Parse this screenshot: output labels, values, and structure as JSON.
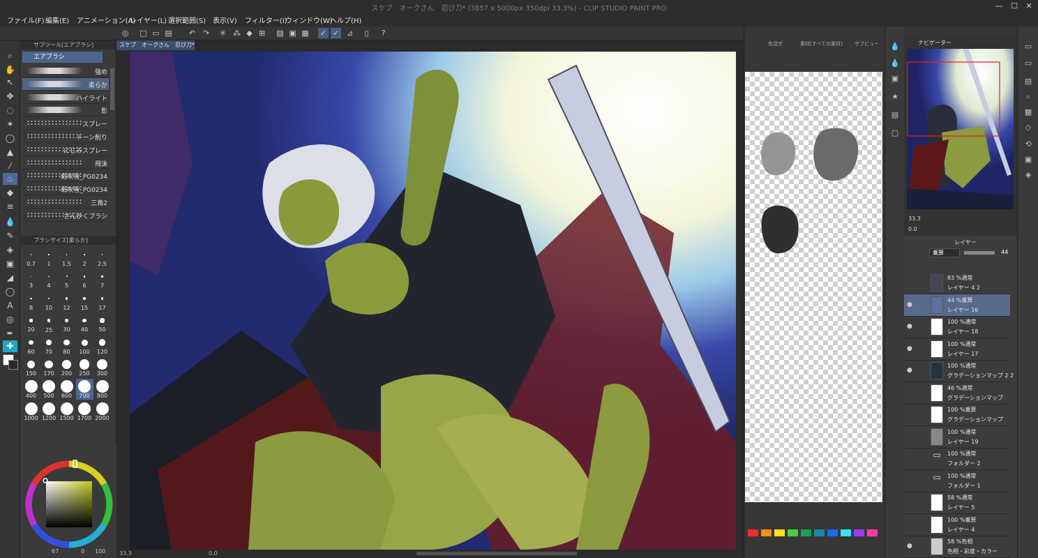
{
  "window": {
    "title": "スケブ　オークさん　忍び刀* (3857 x 5000px 350dpi 33.3%) - CLIP STUDIO PAINT PRO",
    "minimize": "—",
    "maximize": "☐",
    "close": "✕"
  },
  "menu": [
    "ファイル(F)",
    "編集(E)",
    "アニメーション(A)",
    "レイヤー(L)",
    "選択範囲(S)",
    "表示(V)",
    "フィルター(I)",
    "ウィンドウ(W)",
    "ヘルプ(H)"
  ],
  "toolbar": {
    "icons": [
      "undo-icon",
      "redo-icon",
      "select-icon"
    ]
  },
  "document_tab": {
    "label": "スケブ　オークさん　忍び刀*",
    "close": "×"
  },
  "subtool": {
    "header": "サブツール[エアブラシ]",
    "group": "エアブラシ",
    "brushes": [
      "強め",
      "柔らか",
      "ハイライト",
      "影",
      "スプレー",
      "トーン削り",
      "にじみスプレー",
      "飛沫",
      "紙吹雪_PG0234",
      "紙吹雪_PG0234",
      "三角2",
      "さんかくブラシ"
    ],
    "selected_index": 1
  },
  "brush_size": {
    "header": "ブラシサイズ[柔らか]",
    "sizes": [
      "0.7",
      "1",
      "1.5",
      "2",
      "2.5",
      "3",
      "4",
      "5",
      "6",
      "7",
      "8",
      "10",
      "12",
      "15",
      "17",
      "20",
      "25",
      "30",
      "40",
      "50",
      "60",
      "70",
      "80",
      "100",
      "120",
      "150",
      "170",
      "200",
      "250",
      "300",
      "400",
      "500",
      "600",
      "700",
      "800",
      "1000",
      "1200",
      "1500",
      "1700",
      "2000"
    ],
    "selected": "700"
  },
  "color": {
    "hue_accent": "#c0c81e",
    "bottom_left": "67",
    "bottom_right": "100",
    "bottom_mid": "0"
  },
  "canvas_status": {
    "zoom": "33.3",
    "angle": "0.0"
  },
  "sub_view": {
    "tabs": [
      "色混ぜ",
      "素材[すべての素材]",
      "サブビュー"
    ]
  },
  "palette": {
    "colors": [
      "#ff2a2a",
      "#ff8c1a",
      "#ffe21a",
      "#3fd13f",
      "#1aa05a",
      "#1a8aa0",
      "#1a6cff",
      "#3ae0ff",
      "#9a3aff",
      "#ff3aaa"
    ]
  },
  "navigator": {
    "tab": "ナビゲーター",
    "zoom": "33.3",
    "angle": "0.0"
  },
  "layer_panel": {
    "tab": "レイヤー",
    "blend": "乗算",
    "opacity": "44",
    "layers": [
      {
        "pct": "83 %通常",
        "name": "レイヤー 4 2",
        "visible": false,
        "thumb": "#445"
      },
      {
        "pct": "44 %乗算",
        "name": "レイヤー 16",
        "visible": true,
        "selected": true,
        "thumb": "#5a6fa0"
      },
      {
        "pct": "100 %通常",
        "name": "レイヤー 18",
        "visible": true,
        "thumb": "#fff"
      },
      {
        "pct": "100 %通常",
        "name": "レイヤー 17",
        "visible": true,
        "thumb": "#fff"
      },
      {
        "pct": "100 %通常",
        "name": "グラデーションマップ 2 2",
        "visible": true,
        "thumb": "#234"
      },
      {
        "pct": "46 %通常",
        "name": "グラデーションマップ",
        "visible": false,
        "thumb": "#fff"
      },
      {
        "pct": "100 %乗算",
        "name": "グラデーションマップ",
        "visible": false,
        "thumb": "#fff"
      },
      {
        "pct": "100 %通常",
        "name": "レイヤー 19",
        "visible": false,
        "thumb": "#888"
      },
      {
        "pct": "100 %通常",
        "name": "フォルダー 2",
        "visible": false,
        "thumb": "folder"
      },
      {
        "pct": "100 %通常",
        "name": "フォルダー 1",
        "visible": false,
        "thumb": "folder"
      },
      {
        "pct": "58 %通常",
        "name": "レイヤー 5",
        "visible": false,
        "thumb": "#fff"
      },
      {
        "pct": "100 %乗算",
        "name": "レイヤー 4",
        "visible": false,
        "thumb": "#fff"
      },
      {
        "pct": "58 %色相",
        "name": "色相・彩度・カラー",
        "visible": true,
        "thumb": "#ccc"
      }
    ]
  }
}
